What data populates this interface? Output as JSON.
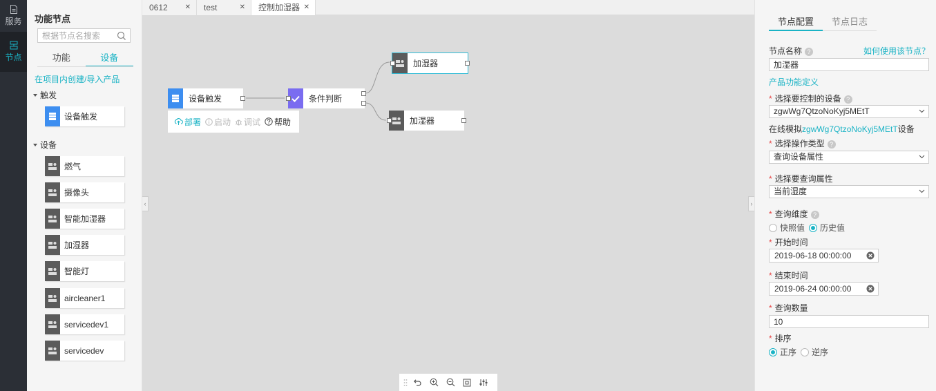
{
  "rail": {
    "items": [
      {
        "label": "服务",
        "icon": "document-icon"
      },
      {
        "label": "节点",
        "icon": "node-icon",
        "active": true
      }
    ]
  },
  "palette": {
    "title": "功能节点",
    "search_placeholder": "根据节点名搜索",
    "tabs": [
      "功能",
      "设备"
    ],
    "active_tab": "设备",
    "create_link": "在项目内创建/导入产品",
    "groups": [
      {
        "label": "触发",
        "nodes": [
          "设备触发"
        ]
      },
      {
        "label": "设备",
        "nodes": [
          "燃气",
          "摄像头",
          "智能加湿器",
          "加湿器",
          "智能灯",
          "aircleaner1",
          "servicedev1",
          "servicedev"
        ]
      }
    ]
  },
  "editor_tabs": [
    {
      "label": "0612"
    },
    {
      "label": "test"
    },
    {
      "label": "控制加湿器",
      "active": true
    }
  ],
  "canvas": {
    "nodes": {
      "trigger": "设备触发",
      "condition": "条件判断",
      "humidifier_top": "加湿器",
      "humidifier_bottom": "加湿器"
    },
    "toolbar": {
      "deploy": "部署",
      "start": "启动",
      "debug": "调试",
      "help": "帮助"
    }
  },
  "panel": {
    "tabs": [
      "节点配置",
      "节点日志"
    ],
    "active_tab": "节点配置",
    "node_name_label": "节点名称",
    "how_to_link": "如何使用该节点？",
    "node_name_value": "加湿器",
    "product_def_link": "产品功能定义",
    "device_label": "选择要控制的设备",
    "device_value": "zgwWg7QtzoNoKyj5MEtT",
    "online_sim_prefix": "在线模拟",
    "online_sim_device": "zgwWg7QtzoNoKyj5MEtT",
    "online_sim_suffix": "设备",
    "op_type_label": "选择操作类型",
    "op_type_value": "查询设备属性",
    "prop_label": "选择要查询属性",
    "prop_value": "当前湿度",
    "dimension_label": "查询维度",
    "dimension_options": [
      "快照值",
      "历史值"
    ],
    "dimension_selected": "历史值",
    "start_label": "开始时间",
    "start_value": "2019-06-18 00:00:00",
    "end_label": "结束时间",
    "end_value": "2019-06-24 00:00:00",
    "count_label": "查询数量",
    "count_value": "10",
    "sort_label": "排序",
    "sort_options": [
      "正序",
      "逆序"
    ],
    "sort_selected": "正序"
  },
  "colors": {
    "accent": "#1ab3c5",
    "trigger_icon": "#3d8ef0",
    "device_icon": "#5b5b5b",
    "condition_icon": "#7a6cf0",
    "required": "#e64242"
  }
}
